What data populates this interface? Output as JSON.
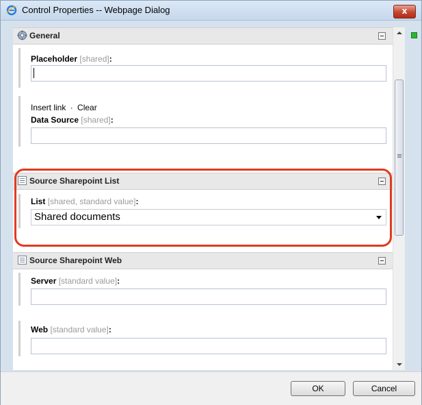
{
  "window": {
    "title": "Control Properties -- Webpage Dialog",
    "close_symbol": "x"
  },
  "sections": {
    "general": {
      "title": "General",
      "placeholder": {
        "label": "Placeholder",
        "note": "[shared]",
        "colon": ":",
        "value": ""
      },
      "links": {
        "insert": "Insert link",
        "sep": "·",
        "clear": "Clear"
      },
      "data_source": {
        "label": "Data Source",
        "note": "[shared]",
        "colon": ":",
        "value": ""
      }
    },
    "source_list": {
      "title": "Source Sharepoint List",
      "list": {
        "label": "List",
        "note": "[shared, standard value]",
        "colon": ":",
        "value": "Shared documents"
      }
    },
    "source_web": {
      "title": "Source Sharepoint Web",
      "server": {
        "label": "Server",
        "note": "[standard value]",
        "colon": ":",
        "value": ""
      },
      "web": {
        "label": "Web",
        "note": "[standard value]",
        "colon": ":",
        "value": ""
      }
    }
  },
  "buttons": {
    "ok": "OK",
    "cancel": "Cancel"
  },
  "colors": {
    "highlight": "#e03a1e",
    "status": "#2db534",
    "close": "#c4452e"
  }
}
